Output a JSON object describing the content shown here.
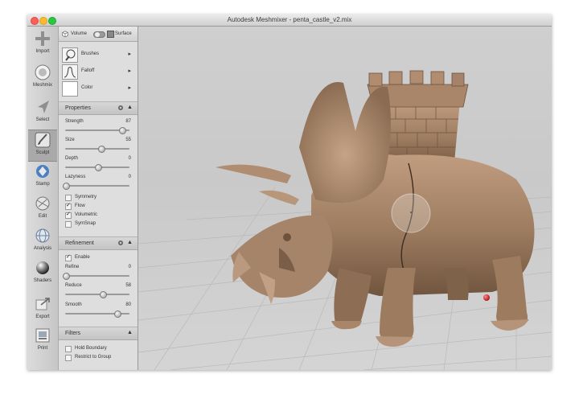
{
  "window": {
    "title": "Autodesk Meshmixer - penta_castle_v2.mix"
  },
  "toolbar": {
    "items": [
      {
        "label": "Import"
      },
      {
        "label": "Meshmix"
      },
      {
        "label": "Select"
      },
      {
        "label": "Sculpt"
      },
      {
        "label": "Stamp"
      },
      {
        "label": "Edit"
      },
      {
        "label": "Analysis"
      },
      {
        "label": "Shaders"
      },
      {
        "label": "Export"
      },
      {
        "label": "Print"
      }
    ],
    "active": "Sculpt"
  },
  "mode_toggle": {
    "left_label": "Volume",
    "right_label": "Surface"
  },
  "brush_panel": {
    "items": [
      {
        "label": "Brushes"
      },
      {
        "label": "Falloff"
      },
      {
        "label": "Color"
      }
    ]
  },
  "properties": {
    "title": "Properties",
    "sliders": [
      {
        "label": "Strength",
        "value": "87",
        "fraction": 0.87
      },
      {
        "label": "Size",
        "value": "55",
        "fraction": 0.55
      },
      {
        "label": "Depth",
        "value": "0",
        "fraction": 0.5
      },
      {
        "label": "Lazyness",
        "value": "0",
        "fraction": 0.0
      }
    ],
    "checks": [
      {
        "label": "Symmetry",
        "checked": false
      },
      {
        "label": "Flow",
        "checked": true
      },
      {
        "label": "Volumetric",
        "checked": true
      },
      {
        "label": "SymSnap",
        "checked": false
      }
    ]
  },
  "refinement": {
    "title": "Refinement",
    "enable": {
      "label": "Enable",
      "checked": true
    },
    "sliders": [
      {
        "label": "Refine",
        "value": "0",
        "fraction": 0.0
      },
      {
        "label": "Reduce",
        "value": "58",
        "fraction": 0.58
      },
      {
        "label": "Smooth",
        "value": "80",
        "fraction": 0.8
      }
    ]
  },
  "filters": {
    "title": "Filters",
    "checks": [
      {
        "label": "Hold Boundary",
        "checked": false
      },
      {
        "label": "Restrict to Group",
        "checked": false
      }
    ]
  },
  "colors": {
    "model": "#9c7b5f",
    "model_shadow": "#6e523c",
    "model_highlight": "#c7a386",
    "grid": "#b9b9b9",
    "marker": "#d6232a"
  }
}
